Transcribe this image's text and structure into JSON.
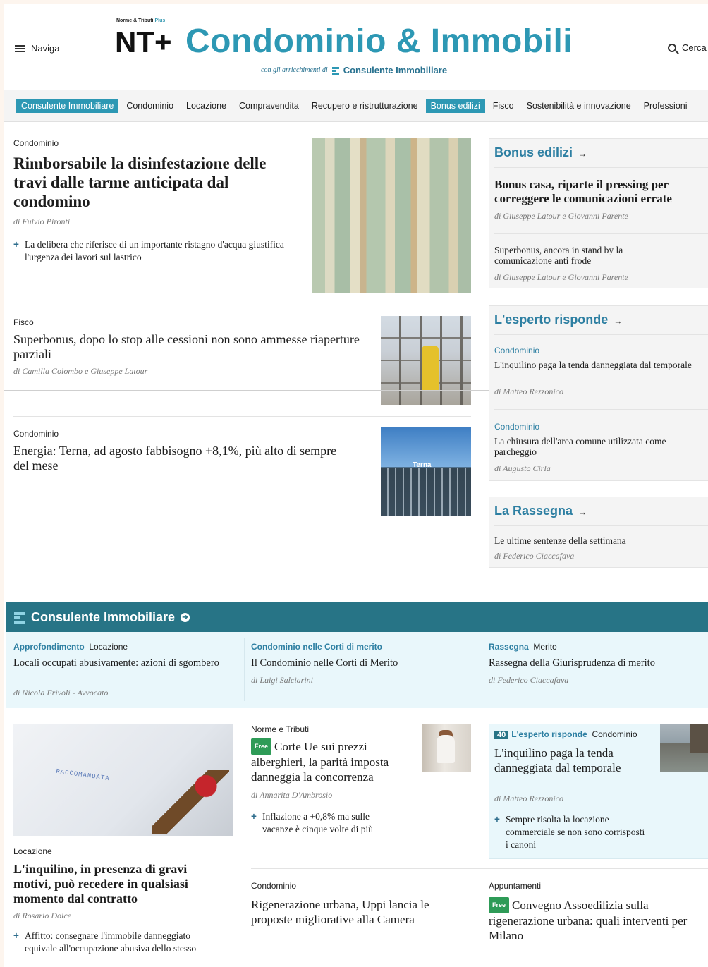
{
  "header": {
    "menu_label": "Naviga",
    "search_label": "Cerca",
    "logo_top_a": "Norme & Tributi",
    "logo_top_b": "Plus",
    "logo_mark": "NT+",
    "brand_title": "Condominio & Immobili",
    "brand_sub_prefix": "con gli arricchimenti di",
    "brand_sub_name": "Consulente Immobiliare"
  },
  "nav": {
    "items": [
      "Consulente Immobiliare",
      "Condominio",
      "Locazione",
      "Compravendita",
      "Recupero e ristrutturazione",
      "Bonus edilizi",
      "Fisco",
      "Sostenibilità e innovazione",
      "Professioni"
    ]
  },
  "main": {
    "lead": {
      "category": "Condominio",
      "title": "Rimborsabile la disinfestazione delle travi dalle tarme anticipata dal condomino",
      "author": "di Fulvio Pironti",
      "related": "La delibera che riferisce di un importante ristagno d'acqua giustifica l'urgenza dei lavori sul lastrico"
    },
    "story2": {
      "category": "Fisco",
      "title": "Superbonus, dopo lo stop alle cessioni non sono ammesse riaperture parziali",
      "author": "di Camilla Colombo e Giuseppe Latour"
    },
    "story3": {
      "category": "Condominio",
      "title": "Energia: Terna, ad agosto fabbisogno +8,1%, più alto di sempre del mese",
      "image_text": "Terna"
    }
  },
  "sidebar": {
    "bonus": {
      "title": "Bonus edilizi",
      "arrow": "→",
      "items": [
        {
          "title": "Bonus casa, riparte il pressing per correggere le comunicazioni errate",
          "author": "di Giuseppe Latour e Giovanni Parente"
        },
        {
          "title": "Superbonus, ancora in stand by la comunicazione anti frode",
          "author": "di Giuseppe Latour e Giovanni Parente"
        }
      ]
    },
    "esperto": {
      "title": "L'esperto risponde",
      "arrow": "→",
      "items": [
        {
          "category": "Condominio",
          "title": "L'inquilino paga la tenda danneggiata dal temporale",
          "author": "di Matteo Rezzonico"
        },
        {
          "category": "Condominio",
          "title": "La chiusura dell'area comune utilizzata come parcheggio",
          "author": "di Augusto Cirla"
        }
      ]
    },
    "rassegna": {
      "title": "La Rassegna",
      "arrow": "→",
      "items": [
        {
          "title": "Le ultime sentenze della settimana",
          "author": "di Federico Ciaccafava"
        }
      ]
    }
  },
  "consulente": {
    "title": "Consulente Immobiliare",
    "cards": [
      {
        "category": "Approfondimento",
        "subcategory": "Locazione",
        "title": "Locali occupati abusivamente: azioni di sgombero",
        "author": "di Nicola Frivoli - Avvocato"
      },
      {
        "category": "Condominio nelle Corti di merito",
        "subcategory": "",
        "title": "Il Condominio nelle Corti di Merito",
        "author": "di Luigi Salciarini"
      },
      {
        "category": "Rassegna",
        "subcategory": "Merito",
        "title": "Rassegna della Giurisprudenza di merito",
        "author": "di Federico Ciaccafava"
      }
    ]
  },
  "bottom": {
    "left": {
      "image_text": "RACCOMANDATA",
      "category": "Locazione",
      "title": "L'inquilino, in presenza di gravi motivi, può recedere in qualsiasi momento dal contratto",
      "author": "di Rosario Dolce",
      "related": "Affitto: consegnare l'immobile danneggiato equivale all'occupazione abusiva dello stesso"
    },
    "middle": {
      "category": "Norme e Tributi",
      "free": "Free",
      "title": "Corte Ue sui prezzi alberghieri, la parità imposta danneggia la concorrenza",
      "author": "di Annarita D'Ambrosio",
      "related": "Inflazione a +0,8% ma sulle vacanze è cinque volte di più"
    },
    "right": {
      "badge": "40",
      "section": "L'esperto risponde",
      "category": "Condominio",
      "title": "L'inquilino paga la tenda danneggiata dal temporale",
      "author": "di Matteo Rezzonico",
      "related": "Sempre risolta la locazione commerciale se non sono corrisposti i canoni"
    },
    "middle2": {
      "category": "Condominio",
      "title": "Rigenerazione urbana, Uppi lancia le proposte migliorative alla Camera"
    },
    "right2": {
      "category": "Appuntamenti",
      "free": "Free",
      "title": "Convegno Assoedilizia sulla rigenerazione urbana: quali interventi per Milano"
    }
  },
  "colors": {
    "brand": "#2d98b4",
    "band": "#277486",
    "free": "#2e9b57",
    "page_bg": "#fdf5ee"
  },
  "icons": [
    "menu-icon",
    "search-icon",
    "arrow-right-icon",
    "consulente-logo-icon",
    "arrow-circle-icon"
  ]
}
